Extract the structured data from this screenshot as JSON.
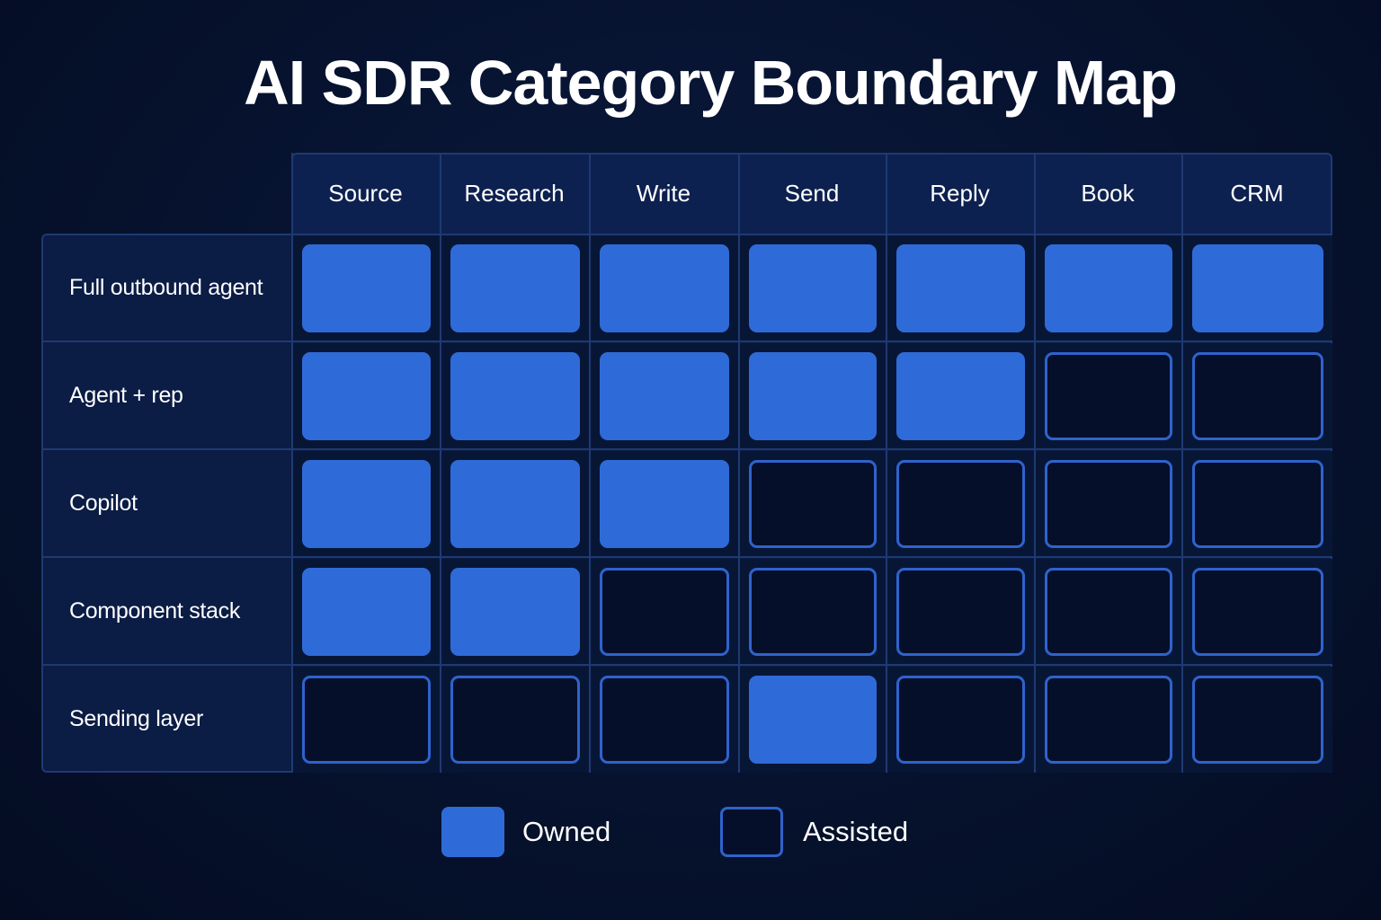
{
  "chart_data": {
    "type": "table",
    "title": "AI SDR Category Boundary Map",
    "columns": [
      "Source",
      "Research",
      "Write",
      "Send",
      "Reply",
      "Book",
      "CRM"
    ],
    "rows": [
      {
        "label": "Full outbound agent",
        "cells": [
          "Owned",
          "Owned",
          "Owned",
          "Owned",
          "Owned",
          "Owned",
          "Owned"
        ]
      },
      {
        "label": "Agent + rep",
        "cells": [
          "Owned",
          "Owned",
          "Owned",
          "Owned",
          "Owned",
          "Assisted",
          "Assisted"
        ]
      },
      {
        "label": "Copilot",
        "cells": [
          "Owned",
          "Owned",
          "Owned",
          "Assisted",
          "Assisted",
          "Assisted",
          "Assisted"
        ]
      },
      {
        "label": "Component stack",
        "cells": [
          "Owned",
          "Owned",
          "Assisted",
          "Assisted",
          "Assisted",
          "Assisted",
          "Assisted"
        ]
      },
      {
        "label": "Sending layer",
        "cells": [
          "Assisted",
          "Assisted",
          "Assisted",
          "Owned",
          "Assisted",
          "Assisted",
          "Assisted"
        ]
      }
    ],
    "legend": [
      {
        "key": "Owned",
        "label": "Owned",
        "color": "#2f6bd8"
      },
      {
        "key": "Assisted",
        "label": "Assisted",
        "color": "#050f2a",
        "border": "#2f63cc"
      }
    ]
  }
}
